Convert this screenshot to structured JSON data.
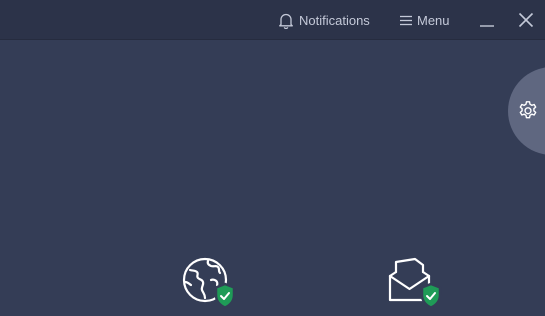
{
  "titlebar": {
    "notifications_label": "Notifications",
    "menu_label": "Menu",
    "icons": {
      "notifications": "bell-icon",
      "menu": "hamburger-icon",
      "minimize": "minimize-icon",
      "close": "close-icon"
    }
  },
  "side_tab": {
    "icon": "gear-icon"
  },
  "features": [
    {
      "icon": "globe-icon",
      "status_icon": "shield-check-icon"
    },
    {
      "icon": "envelope-icon",
      "status_icon": "shield-check-icon"
    }
  ],
  "colors": {
    "background": "#343d56",
    "titlebar": "#2c3349",
    "side_tab": "#5f6780",
    "shield_green": "#1f9b57",
    "text": "#c4c9d8"
  }
}
